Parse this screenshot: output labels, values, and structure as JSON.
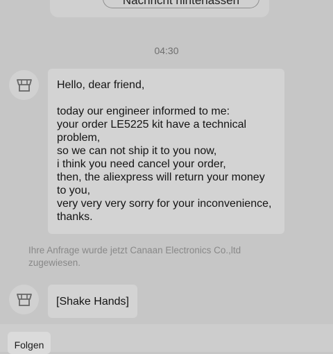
{
  "top_card": {
    "leave_message_label": "Nachricht hinterlassen"
  },
  "timestamp": "04:30",
  "messages": [
    {
      "lines": [
        "Hello, dear friend,",
        "",
        "today our engineer informed to me:",
        "your order LE5225 kit have a technical",
        "problem,",
        "so we can not ship it to you now,",
        "i think you need cancel your order,",
        "then, the aliexpress will return your money",
        "to you,",
        "very very very sorry for your inconvenience,",
        "thanks."
      ]
    },
    {
      "text": "[Shake Hands]"
    }
  ],
  "system_note": "Ihre Anfrage wurde jetzt Canaan Electronics Co.,ltd zugewiesen.",
  "bottom_bar": {
    "follow_label": "Folgen"
  },
  "icons": {
    "avatar": "store-icon"
  },
  "colors": {
    "background": "#c6c6c6",
    "bubble": "#d3d3d3",
    "muted_text": "#888888"
  }
}
